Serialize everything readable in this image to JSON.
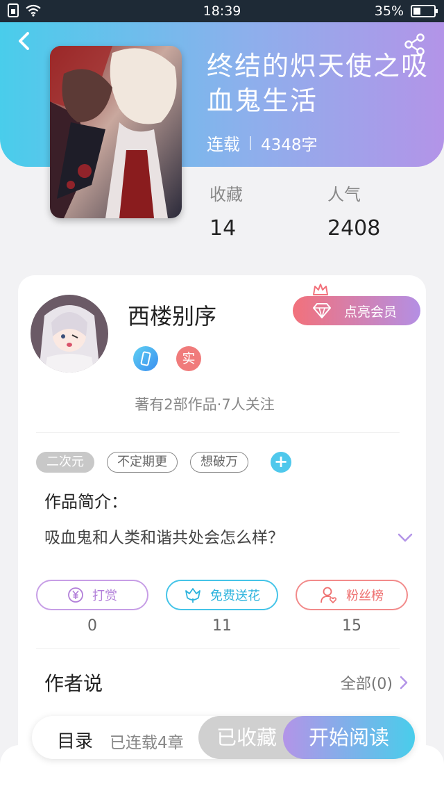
{
  "status_bar": {
    "time": "18:39",
    "battery": "35%",
    "battery_level": 0.35
  },
  "book": {
    "title": "终结的炽天使之吸血鬼生活",
    "status": "连载",
    "word_count": "4348字"
  },
  "stats": [
    {
      "label": "收藏",
      "value": "14"
    },
    {
      "label": "人气",
      "value": "2408"
    }
  ],
  "author": {
    "name": "西楼别序",
    "badge_real": "实",
    "works_info": "著有2部作品·7人关注"
  },
  "vip_button": {
    "label": "点亮会员"
  },
  "tags": [
    {
      "label": "二次元"
    },
    {
      "label": "不定期更"
    },
    {
      "label": "想破万"
    }
  ],
  "tag_add": "+",
  "intro": {
    "title": "作品简介：",
    "text": "吸血鬼和人类和谐共处会怎么样？"
  },
  "actions": [
    {
      "label": "打赏",
      "count": "0",
      "icon": "yen-coin-icon"
    },
    {
      "label": "免费送花",
      "count": "11",
      "icon": "flower-icon"
    },
    {
      "label": "粉丝榜",
      "count": "15",
      "icon": "fan-user-icon"
    }
  ],
  "author_says": {
    "title": "作者说",
    "all": "全部(0)"
  },
  "bottom_bar": {
    "toc": "目录",
    "toc_sub": "已连载4章",
    "collected": "已收藏",
    "read": "开始阅读"
  },
  "colors": {
    "header_start": "#49cdeb",
    "header_end": "#b394e8",
    "tip": "#b27fd9",
    "flower": "#2db3dd",
    "fans": "#ee6e6e"
  }
}
